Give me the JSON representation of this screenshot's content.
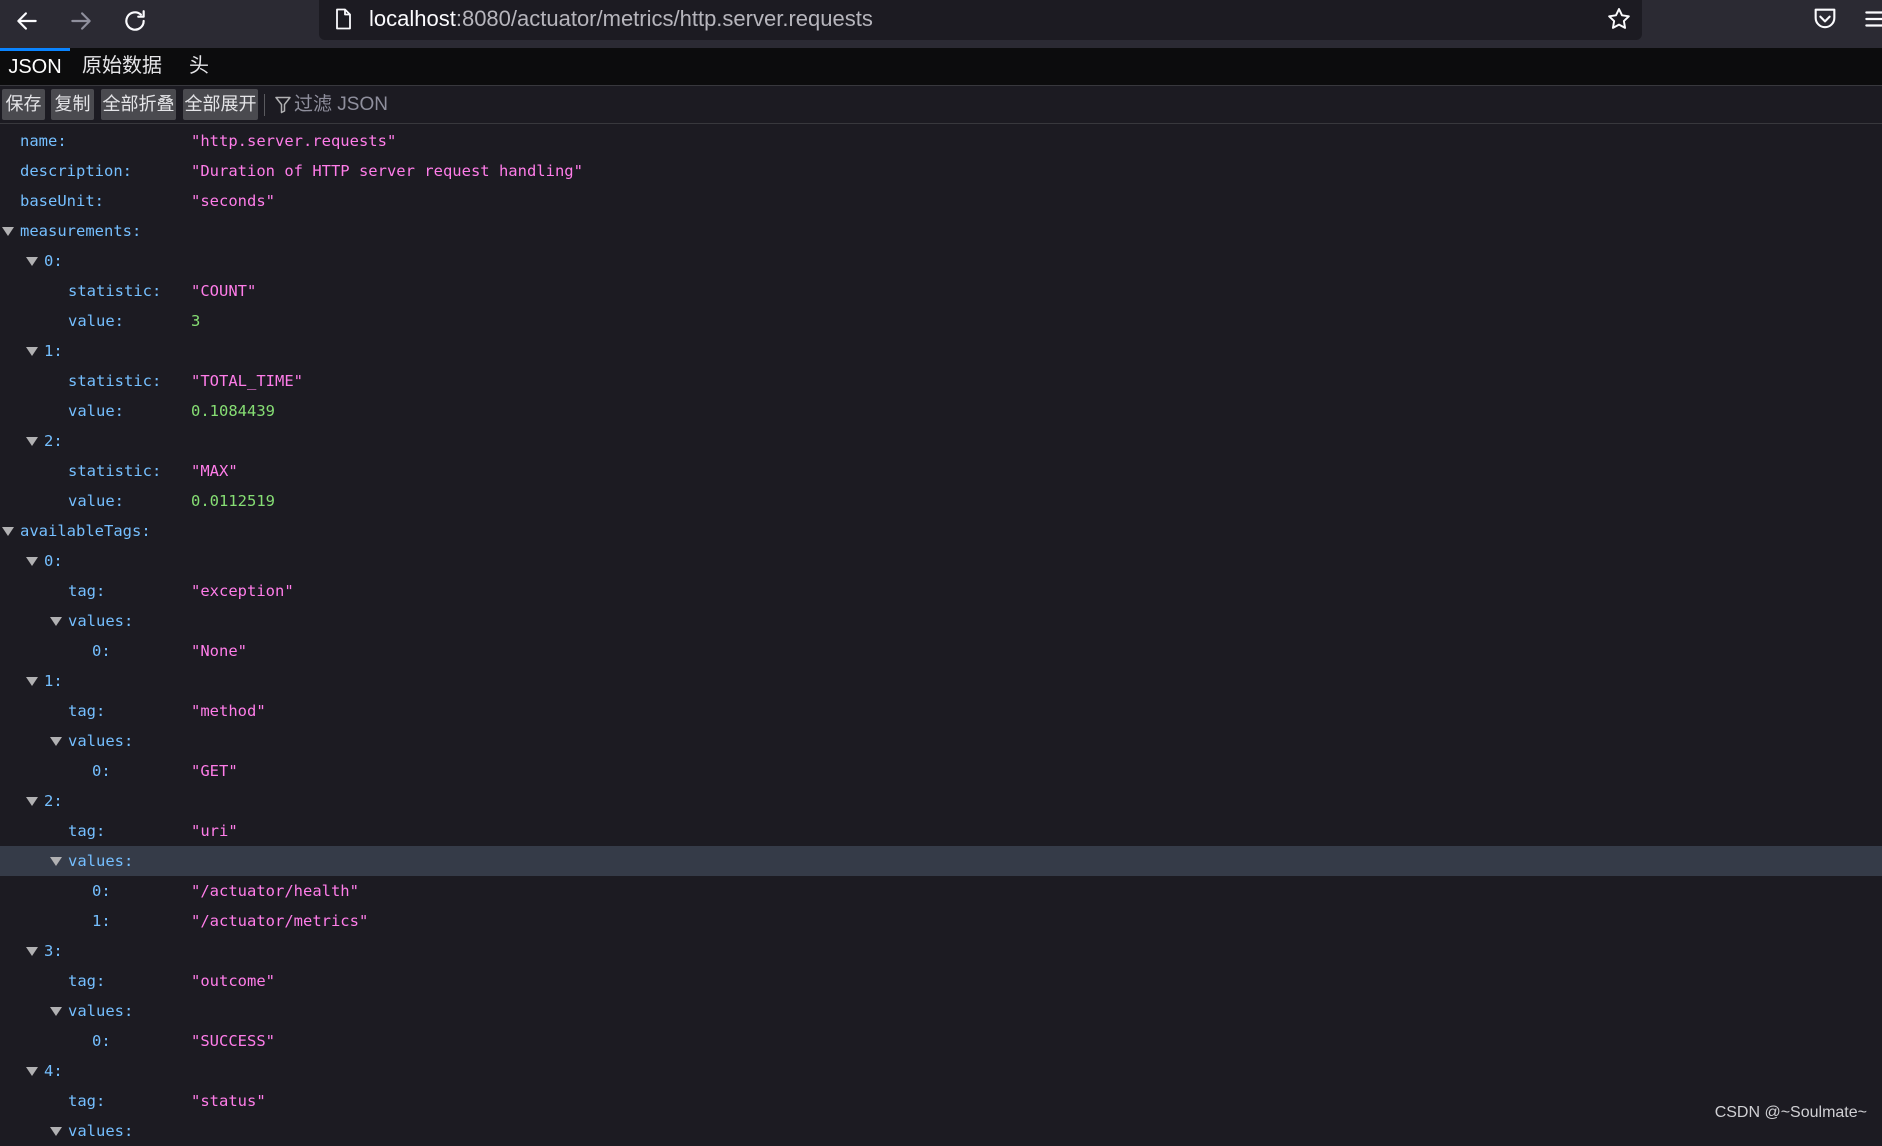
{
  "browser": {
    "url_host": "localhost",
    "url_path": ":8080/actuator/metrics/http.server.requests"
  },
  "tabs": [
    {
      "label": "JSON",
      "active": true
    },
    {
      "label": "原始数据",
      "active": false
    },
    {
      "label": "头",
      "active": false
    }
  ],
  "toolbar": {
    "save_label": "保存",
    "copy_label": "复制",
    "collapse_all_label": "全部折叠",
    "expand_all_label": "全部展开",
    "filter_placeholder": "过滤 JSON"
  },
  "tree": {
    "rows": [
      {
        "key": "name:",
        "value": "\"http.server.requests\"",
        "type": "str",
        "depth": 0,
        "expanded": false
      },
      {
        "key": "description:",
        "value": "\"Duration of HTTP server request handling\"",
        "type": "str",
        "depth": 0,
        "expanded": false
      },
      {
        "key": "baseUnit:",
        "value": "\"seconds\"",
        "type": "str",
        "depth": 0,
        "expanded": false
      },
      {
        "key": "measurements:",
        "value": "",
        "type": "obj",
        "depth": 0,
        "expanded": true
      },
      {
        "key": "0:",
        "value": "",
        "type": "obj",
        "depth": 1,
        "expanded": true
      },
      {
        "key": "statistic:",
        "value": "\"COUNT\"",
        "type": "str",
        "depth": 2,
        "expanded": false
      },
      {
        "key": "value:",
        "value": "3",
        "type": "num",
        "depth": 2,
        "expanded": false
      },
      {
        "key": "1:",
        "value": "",
        "type": "obj",
        "depth": 1,
        "expanded": true
      },
      {
        "key": "statistic:",
        "value": "\"TOTAL_TIME\"",
        "type": "str",
        "depth": 2,
        "expanded": false
      },
      {
        "key": "value:",
        "value": "0.1084439",
        "type": "num",
        "depth": 2,
        "expanded": false
      },
      {
        "key": "2:",
        "value": "",
        "type": "obj",
        "depth": 1,
        "expanded": true
      },
      {
        "key": "statistic:",
        "value": "\"MAX\"",
        "type": "str",
        "depth": 2,
        "expanded": false
      },
      {
        "key": "value:",
        "value": "0.0112519",
        "type": "num",
        "depth": 2,
        "expanded": false
      },
      {
        "key": "availableTags:",
        "value": "",
        "type": "obj",
        "depth": 0,
        "expanded": true
      },
      {
        "key": "0:",
        "value": "",
        "type": "obj",
        "depth": 1,
        "expanded": true
      },
      {
        "key": "tag:",
        "value": "\"exception\"",
        "type": "str",
        "depth": 2,
        "expanded": false
      },
      {
        "key": "values:",
        "value": "",
        "type": "obj",
        "depth": 2,
        "expanded": true
      },
      {
        "key": "0:",
        "value": "\"None\"",
        "type": "str",
        "depth": 3,
        "expanded": false
      },
      {
        "key": "1:",
        "value": "",
        "type": "obj",
        "depth": 1,
        "expanded": true
      },
      {
        "key": "tag:",
        "value": "\"method\"",
        "type": "str",
        "depth": 2,
        "expanded": false
      },
      {
        "key": "values:",
        "value": "",
        "type": "obj",
        "depth": 2,
        "expanded": true
      },
      {
        "key": "0:",
        "value": "\"GET\"",
        "type": "str",
        "depth": 3,
        "expanded": false
      },
      {
        "key": "2:",
        "value": "",
        "type": "obj",
        "depth": 1,
        "expanded": true
      },
      {
        "key": "tag:",
        "value": "\"uri\"",
        "type": "str",
        "depth": 2,
        "expanded": false
      },
      {
        "key": "values:",
        "value": "",
        "type": "obj",
        "depth": 2,
        "expanded": true,
        "selected": true
      },
      {
        "key": "0:",
        "value": "\"/actuator/health\"",
        "type": "str",
        "depth": 3,
        "expanded": false
      },
      {
        "key": "1:",
        "value": "\"/actuator/metrics\"",
        "type": "str",
        "depth": 3,
        "expanded": false
      },
      {
        "key": "3:",
        "value": "",
        "type": "obj",
        "depth": 1,
        "expanded": true
      },
      {
        "key": "tag:",
        "value": "\"outcome\"",
        "type": "str",
        "depth": 2,
        "expanded": false
      },
      {
        "key": "values:",
        "value": "",
        "type": "obj",
        "depth": 2,
        "expanded": true
      },
      {
        "key": "0:",
        "value": "\"SUCCESS\"",
        "type": "str",
        "depth": 3,
        "expanded": false
      },
      {
        "key": "4:",
        "value": "",
        "type": "obj",
        "depth": 1,
        "expanded": true
      },
      {
        "key": "tag:",
        "value": "\"status\"",
        "type": "str",
        "depth": 2,
        "expanded": false
      },
      {
        "key": "values:",
        "value": "",
        "type": "obj",
        "depth": 2,
        "expanded": true
      }
    ]
  },
  "watermark": "CSDN @~Soulmate~"
}
